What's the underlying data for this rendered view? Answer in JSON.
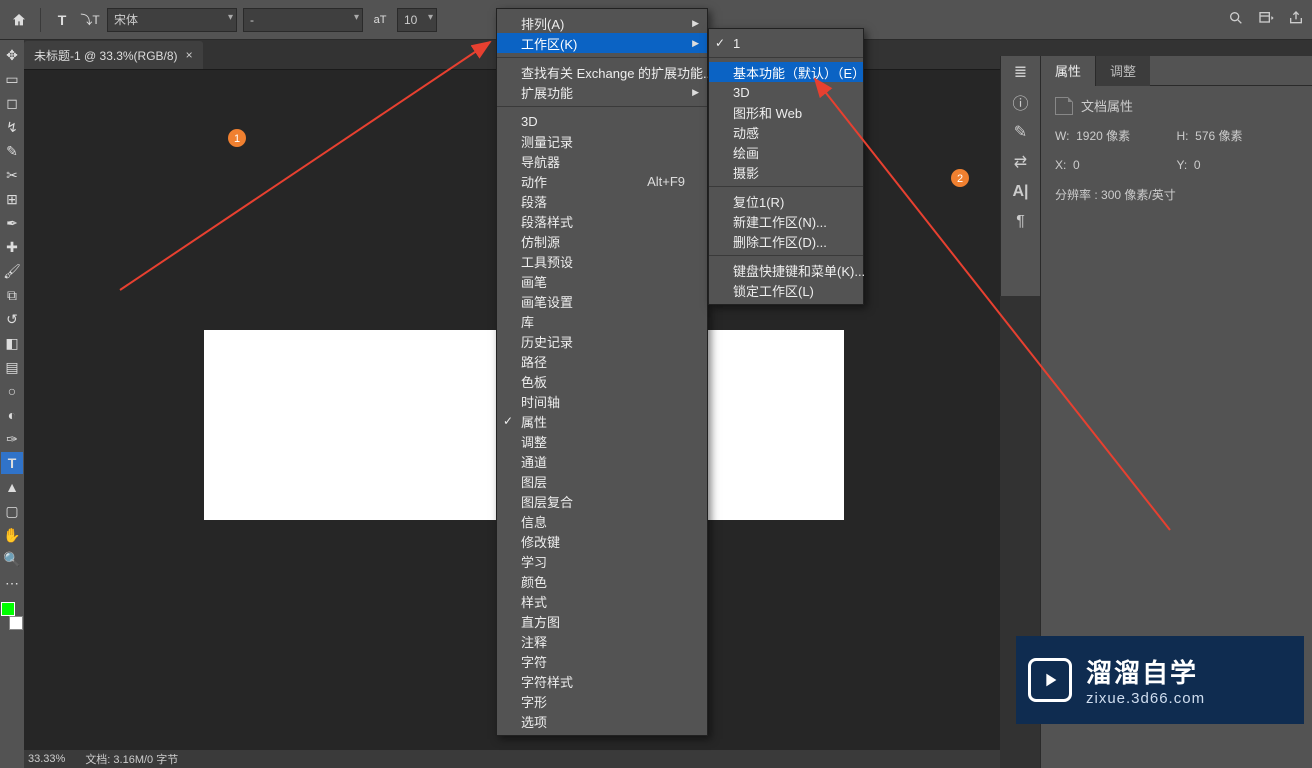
{
  "option_bar": {
    "font_family": "宋体",
    "font_style": "-",
    "font_size": "10 点"
  },
  "doc_tab": {
    "title": "未标题-1 @ 33.3%(RGB/8)",
    "close": "×"
  },
  "menu1": {
    "arrange": "排列(A)",
    "workspace": "工作区(K)",
    "find_ext": "查找有关 Exchange 的扩展功能...",
    "extensions": "扩展功能",
    "items": [
      "3D",
      "测量记录",
      "导航器",
      "动作",
      "段落",
      "段落样式",
      "仿制源",
      "工具预设",
      "画笔",
      "画笔设置",
      "库",
      "历史记录",
      "路径",
      "色板",
      "时间轴",
      "属性",
      "调整",
      "通道",
      "图层",
      "图层复合",
      "信息",
      "修改键",
      "学习",
      "颜色",
      "样式",
      "直方图",
      "注释",
      "字符",
      "字符样式",
      "字形",
      "选项"
    ],
    "shortcut_actions": "Alt+F9",
    "checked_item": "属性"
  },
  "submenu": {
    "one": "1",
    "essentials": "基本功能（默认）（E）",
    "three_d": "3D",
    "graphic_web": "图形和 Web",
    "motion": "动感",
    "painting": "绘画",
    "photography": "摄影",
    "reset": "复位1(R)",
    "new_ws": "新建工作区(N)...",
    "delete_ws": "删除工作区(D)...",
    "keyboard": "键盘快捷键和菜单(K)...",
    "lock_ws": "锁定工作区(L)"
  },
  "properties": {
    "tab_props": "属性",
    "tab_adjust": "调整",
    "doc_attr": "文档属性",
    "w_label": "W:",
    "w_val": "1920 像素",
    "h_label": "H:",
    "h_val": "576 像素",
    "x_label": "X:",
    "x_val": "0",
    "y_label": "Y:",
    "y_val": "0",
    "res_label": "分辨率 :",
    "res_val": "300 像素/英寸"
  },
  "status": {
    "zoom": "33.33%",
    "docinfo": "文档: 3.16M/0 字节"
  },
  "watermark": {
    "cn": "溜溜自学",
    "en": "zixue.3d66.com"
  },
  "badges": {
    "b1": "1",
    "b2": "2"
  }
}
